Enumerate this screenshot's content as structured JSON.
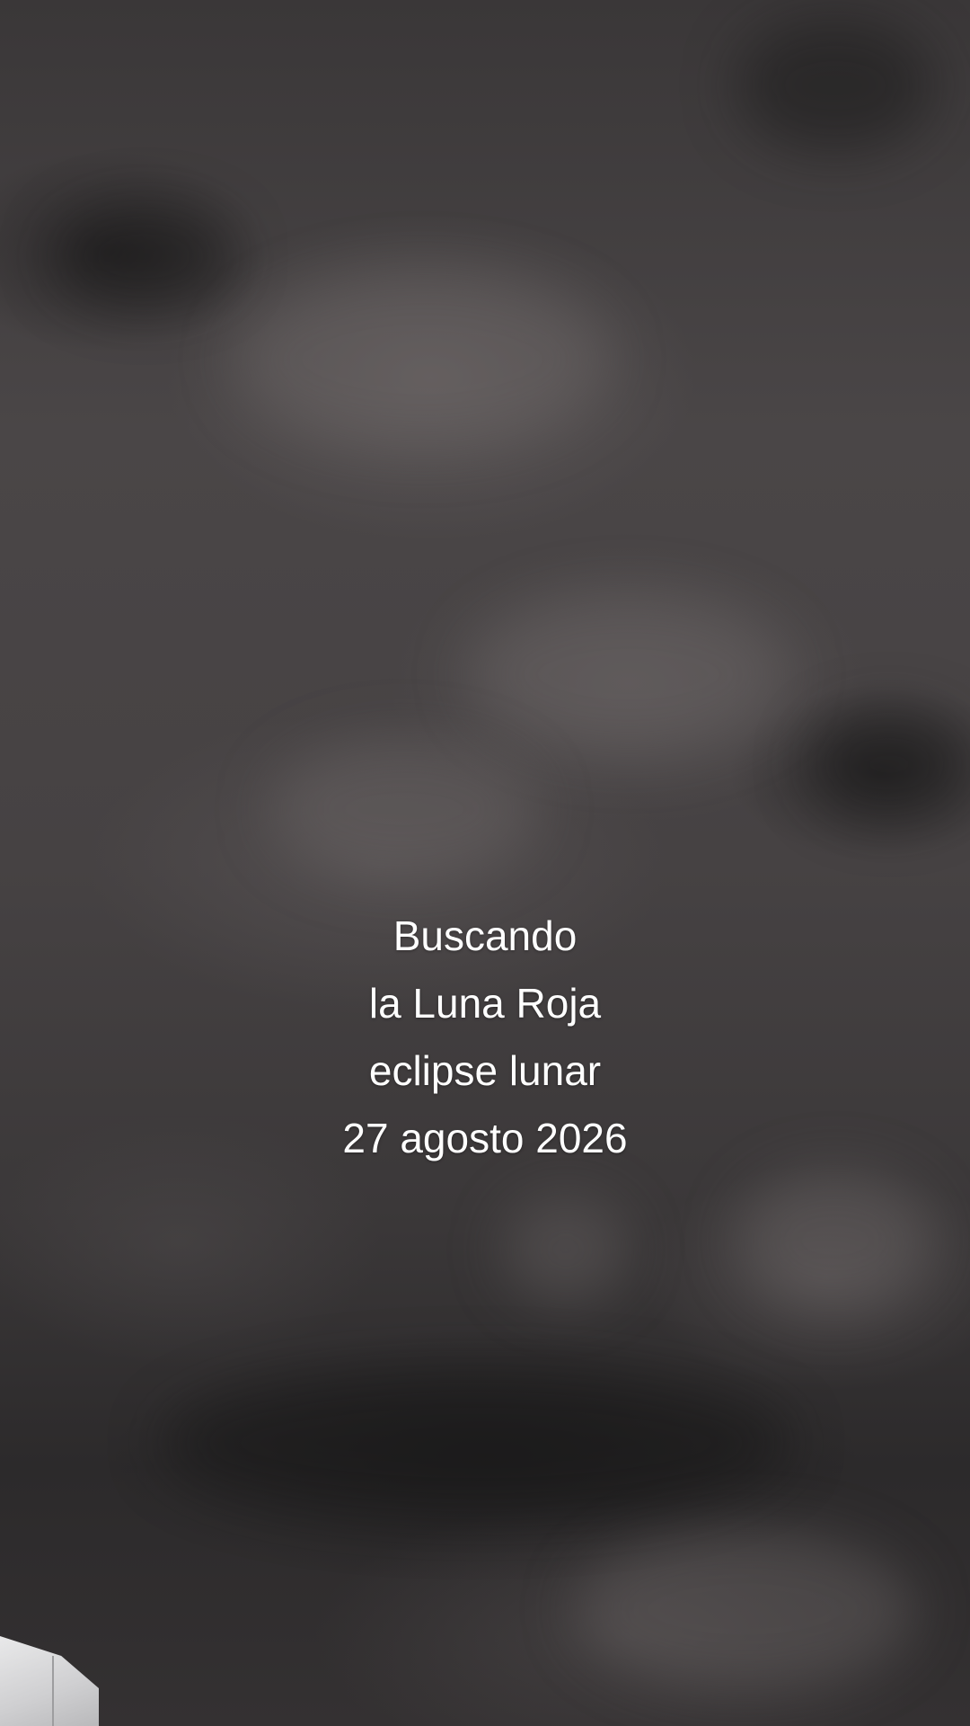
{
  "overlay": {
    "lines": [
      "Buscando",
      "la Luna Roja",
      "eclipse lunar",
      "27 agosto 2026"
    ]
  },
  "scene": {
    "subject": "cloudy-night-sky",
    "colors": {
      "sky_dark": "#2a2829",
      "sky_mid": "#4a4647",
      "text": "#ffffff",
      "building": "#e9e9ea"
    }
  }
}
